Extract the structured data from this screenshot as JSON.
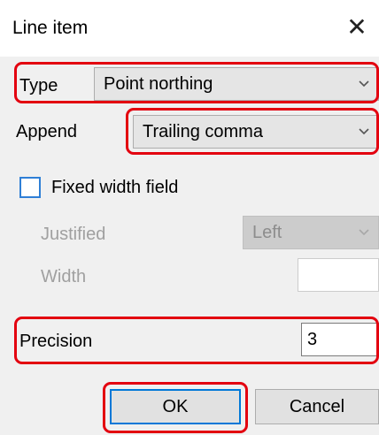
{
  "dialog": {
    "title": "Line item",
    "close_glyph": "✕"
  },
  "type": {
    "label": "Type",
    "value": "Point northing"
  },
  "append": {
    "label": "Append",
    "value": "Trailing comma"
  },
  "fixed_width": {
    "label": "Fixed width field",
    "checked": false
  },
  "justified": {
    "label": "Justified",
    "value": "Left"
  },
  "width": {
    "label": "Width",
    "value": ""
  },
  "precision": {
    "label": "Precision",
    "value": "3"
  },
  "buttons": {
    "ok": "OK",
    "cancel": "Cancel"
  },
  "colors": {
    "highlight": "#e3000f",
    "accent": "#0078d7",
    "checkbox_border": "#2f7fd6"
  }
}
